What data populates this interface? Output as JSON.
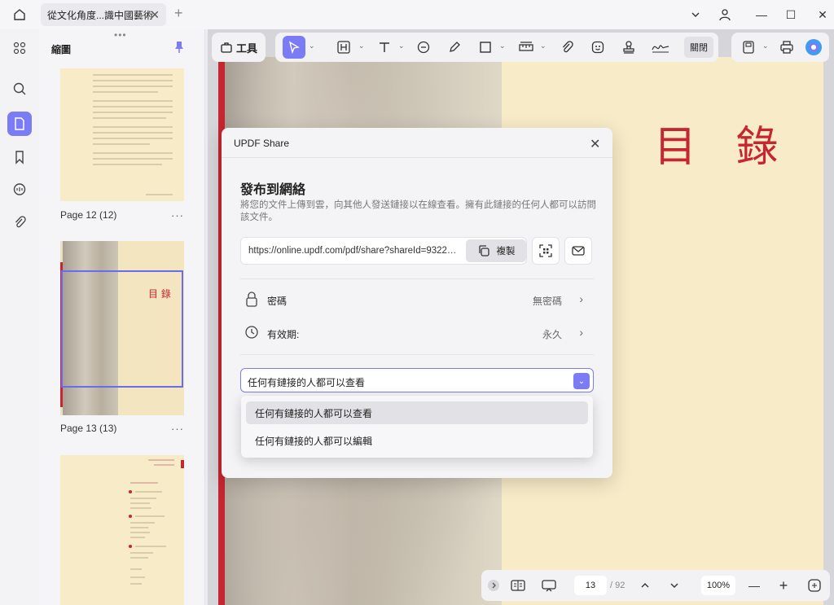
{
  "tabbar": {
    "tab_title": "從文化角度...識中國藝術",
    "tab_close": "✕",
    "add_tab": "+"
  },
  "window": {
    "minimize": "—",
    "maximize": "☐",
    "close": "✕"
  },
  "thumbnails": {
    "title": "縮圖",
    "top_dots": "•••",
    "pages": [
      {
        "label": "Page 12 (12)",
        "more": "···"
      },
      {
        "label": "Page 13 (13)",
        "more": "···",
        "heading": "目 錄"
      },
      {
        "label": "",
        "more": ""
      }
    ]
  },
  "toolbar": {
    "tools_label": "工具",
    "close_label": "關閉"
  },
  "document": {
    "heading": "目 錄"
  },
  "share_dialog": {
    "title": "UPDF Share",
    "close": "✕",
    "heading": "發布到網絡",
    "description": "將您的文件上傳到雲，向其他人發送鏈接以在線查看。擁有此鏈接的任何人都可以訪問該文件。",
    "url": "https://online.updf.com/pdf/share?shareId=932225...",
    "copy_label": "複製",
    "password_label": "密碼",
    "password_value": "無密碼",
    "validity_label": "有效期:",
    "validity_value": "永久",
    "permission_selected": "任何有鏈接的人都可以查看",
    "permission_options": [
      "任何有鏈接的人都可以查看",
      "任何有鏈接的人都可以編輯"
    ]
  },
  "bottombar": {
    "page_current": "13",
    "page_total": "/ 92",
    "zoom": "100%",
    "zoom_out": "—",
    "zoom_in": "+"
  },
  "colors": {
    "accent": "#7b7cf5",
    "document_red": "#c6262f",
    "page_cream": "#f8ebc8"
  }
}
